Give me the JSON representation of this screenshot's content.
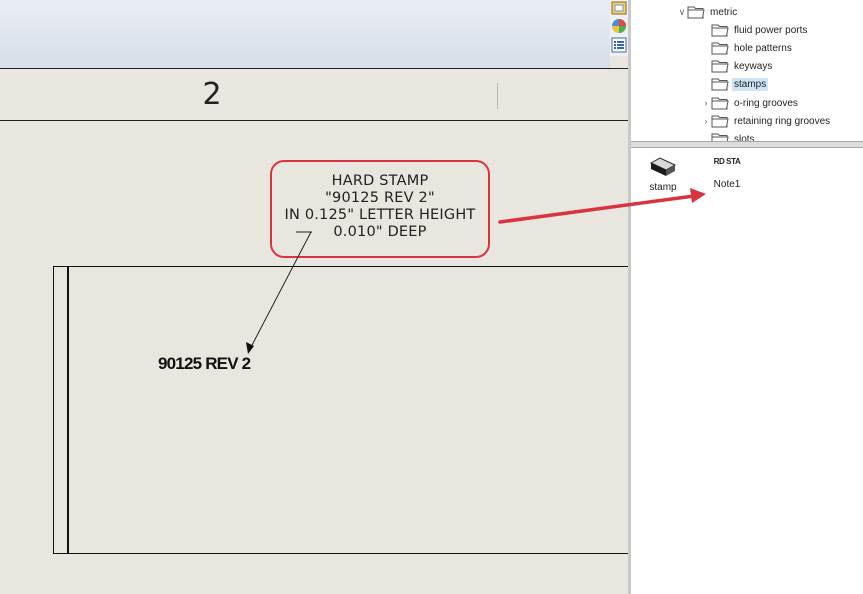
{
  "drawing": {
    "zone_label": "2",
    "note": {
      "lines": [
        "HARD STAMP",
        "\"90125 REV 2\"",
        "IN 0.125\" LETTER HEIGHT",
        "0.010\" DEEP"
      ]
    },
    "stamp_text": "90125 REV 2"
  },
  "tree": {
    "parent": "metric",
    "items": [
      {
        "label": "fluid power ports",
        "expandable": false
      },
      {
        "label": "hole patterns",
        "expandable": false
      },
      {
        "label": "keyways",
        "expandable": false
      },
      {
        "label": "stamps",
        "expandable": false,
        "selected": true
      },
      {
        "label": "o-ring grooves",
        "expandable": true
      },
      {
        "label": "retaining ring grooves",
        "expandable": true
      },
      {
        "label": "slots",
        "expandable": false
      }
    ]
  },
  "files": [
    {
      "label": "stamp",
      "icon": "stamp-part-icon"
    },
    {
      "label": "Note1",
      "icon": "note-thumbnail-icon",
      "thumbnail_text": "RD STA"
    }
  ],
  "colors": {
    "annotation_red": "#d9333f",
    "selection": "#cce4f7",
    "sheet": "#e8e6df"
  }
}
